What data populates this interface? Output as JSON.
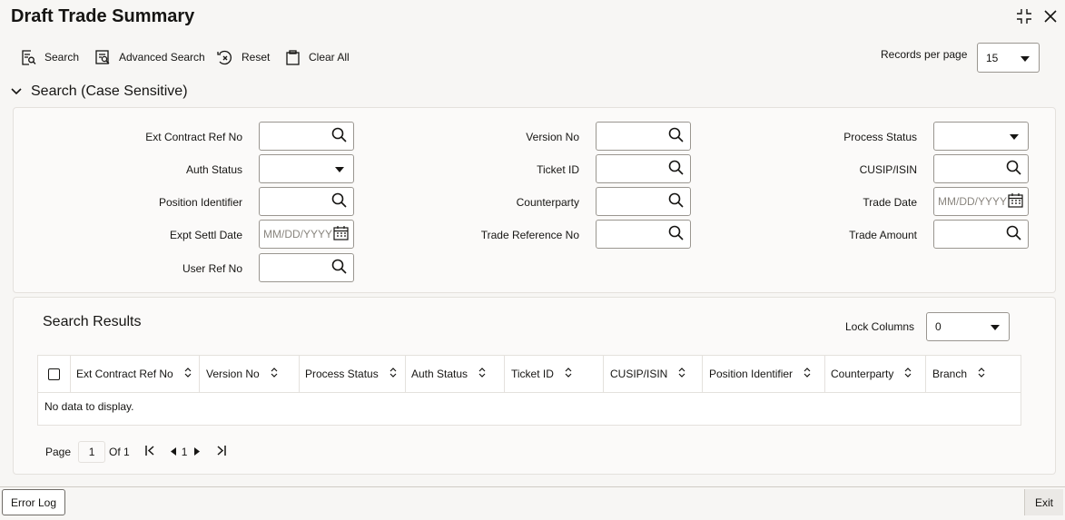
{
  "window": {
    "title": "Draft Trade Summary"
  },
  "toolbar": {
    "search": "Search",
    "advanced_search": "Advanced Search",
    "reset": "Reset",
    "clear_all": "Clear All",
    "records_per_page_label": "Records per page",
    "records_per_page_value": "15"
  },
  "search_section": {
    "title": "Search (Case Sensitive)",
    "fields": {
      "ext_contract_ref_no": "Ext Contract Ref No",
      "auth_status": "Auth Status",
      "position_identifier": "Position Identifier",
      "expt_settl_date": "Expt Settl Date",
      "user_ref_no": "User Ref No",
      "version_no": "Version No",
      "ticket_id": "Ticket ID",
      "counterparty": "Counterparty",
      "trade_reference_no": "Trade Reference No",
      "process_status": "Process Status",
      "cusip_isin": "CUSIP/ISIN",
      "trade_date": "Trade Date",
      "trade_amount": "Trade Amount"
    },
    "date_placeholder": "MM/DD/YYYY"
  },
  "results": {
    "title": "Search Results",
    "lock_columns_label": "Lock Columns",
    "lock_columns_value": "0",
    "columns": [
      "Ext Contract Ref No",
      "Version No",
      "Process Status",
      "Auth Status",
      "Ticket ID",
      "CUSIP/ISIN",
      "Position Identifier",
      "Counterparty",
      "Branch"
    ],
    "empty_message": "No data to display."
  },
  "pagination": {
    "page_label": "Page",
    "current_page": "1",
    "of_label": "Of 1",
    "page_number": "1"
  },
  "footer": {
    "error_log": "Error Log",
    "exit": "Exit"
  },
  "icons": {
    "search": "search-icon",
    "calendar": "calendar-icon",
    "dropdown": "chevron-down-icon",
    "sort": "sort-icon"
  }
}
